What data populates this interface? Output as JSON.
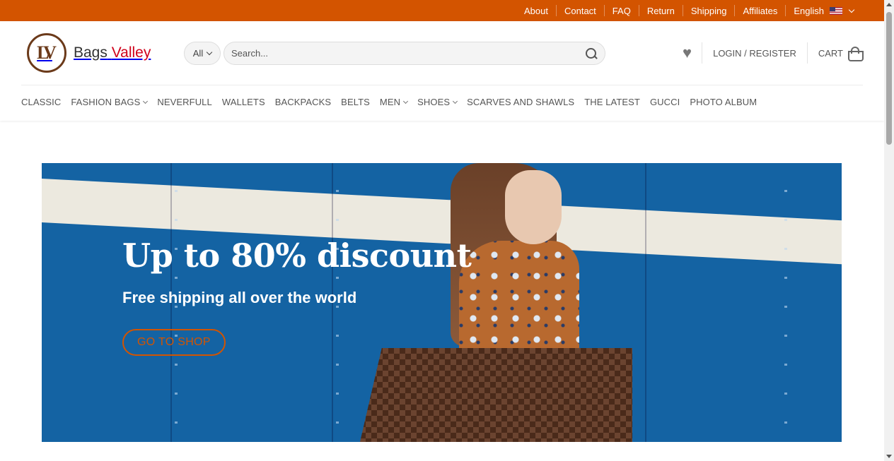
{
  "topbar": {
    "links": [
      "About",
      "Contact",
      "FAQ",
      "Return",
      "Shipping",
      "Affiliates"
    ],
    "language": "English",
    "color": "#d35400"
  },
  "header": {
    "logo": {
      "monogram": "LV",
      "word1": "Bags",
      "word2": "Valley"
    },
    "category_select": "All",
    "search": {
      "placeholder": "Search..."
    },
    "login_label": "LOGIN / REGISTER",
    "cart_label": "CART",
    "icons": {
      "wishlist": "heart-icon",
      "search": "search-icon",
      "cart": "basket-icon"
    }
  },
  "nav": {
    "items": [
      {
        "label": "CLASSIC",
        "dropdown": false
      },
      {
        "label": "FASHION BAGS",
        "dropdown": true
      },
      {
        "label": "NEVERFULL",
        "dropdown": false
      },
      {
        "label": "WALLETS",
        "dropdown": false
      },
      {
        "label": "BACKPACKS",
        "dropdown": false
      },
      {
        "label": "BELTS",
        "dropdown": false
      },
      {
        "label": "MEN",
        "dropdown": true
      },
      {
        "label": "SHOES",
        "dropdown": true
      },
      {
        "label": "SCARVES AND SHAWLS",
        "dropdown": false
      },
      {
        "label": "THE LATEST",
        "dropdown": false
      },
      {
        "label": "GUCCI",
        "dropdown": false
      },
      {
        "label": "PHOTO ALBUM",
        "dropdown": false
      }
    ]
  },
  "hero": {
    "title": "Up to 80% discount",
    "subtitle": "Free shipping all over the world",
    "button": "GO TO SHOP",
    "accent": "#d35400"
  }
}
